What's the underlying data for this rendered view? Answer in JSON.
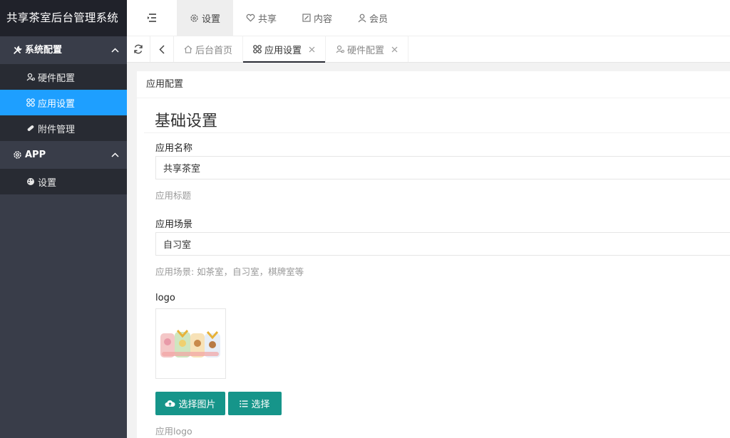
{
  "app": {
    "title": "共享茶室后台管理系统"
  },
  "sidebar": {
    "groups": [
      {
        "label": "系统配置",
        "icon": "tools-icon",
        "expanded": true,
        "items": [
          {
            "label": "硬件配置",
            "icon": "user-icon",
            "active": false
          },
          {
            "label": "应用设置",
            "icon": "grid-icon",
            "active": true
          },
          {
            "label": "附件管理",
            "icon": "attachment-icon",
            "active": false
          }
        ]
      },
      {
        "label": "APP",
        "icon": "gear-icon",
        "expanded": true,
        "items": [
          {
            "label": "设置",
            "icon": "palette-icon",
            "active": false
          }
        ]
      }
    ]
  },
  "header": {
    "nav": [
      {
        "label": "设置",
        "icon": "gear-icon",
        "active": true
      },
      {
        "label": "共享",
        "icon": "heart-icon",
        "active": false
      },
      {
        "label": "内容",
        "icon": "edit-icon",
        "active": false
      },
      {
        "label": "会员",
        "icon": "user-icon",
        "active": false
      }
    ]
  },
  "tabs": [
    {
      "label": "后台首页",
      "icon": "home-icon",
      "active": false,
      "closable": false
    },
    {
      "label": "应用设置",
      "icon": "grid-icon",
      "active": true,
      "closable": true
    },
    {
      "label": "硬件配置",
      "icon": "user-icon",
      "active": false,
      "closable": true
    }
  ],
  "page": {
    "card_title": "应用配置",
    "section_title": "基础设置",
    "fields": {
      "app_name": {
        "label": "应用名称",
        "value": "共享茶室",
        "hint": "应用标题"
      },
      "app_scene": {
        "label": "应用场景",
        "value": "自习室",
        "hint": "应用场景: 如茶室，自习室，棋牌室等"
      },
      "logo": {
        "label": "logo",
        "hint": "应用logo"
      }
    },
    "buttons": {
      "upload": "选择图片",
      "select": "选择"
    }
  },
  "colors": {
    "accent": "#1e9fff",
    "primary_button": "#16958a",
    "sidebar": "#393d49",
    "sidebar_dark": "#20222a"
  }
}
